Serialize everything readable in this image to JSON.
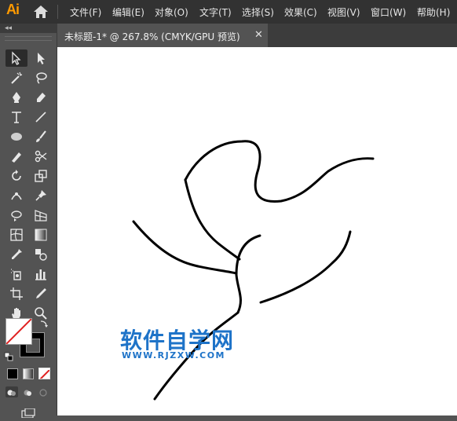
{
  "app": {
    "logo": "Ai"
  },
  "menubar": {
    "items": [
      "文件(F)",
      "编辑(E)",
      "对象(O)",
      "文字(T)",
      "选择(S)",
      "效果(C)",
      "视图(V)",
      "窗口(W)",
      "帮助(H)"
    ]
  },
  "tools_panel": {
    "collapse_glyph": "◂◂"
  },
  "document": {
    "tab_label": "未标题-1* @ 267.8% (CMYK/GPU 预览)",
    "close_glyph": "✕"
  },
  "watermark": {
    "title": "软件自学网",
    "url": "WWW.RJZXW.COM"
  },
  "colors": {
    "menubar_bg": "#323232",
    "panel_bg": "#535353",
    "logo": "#ff9a00",
    "watermark": "#1e73c8",
    "stroke": "#000000"
  }
}
